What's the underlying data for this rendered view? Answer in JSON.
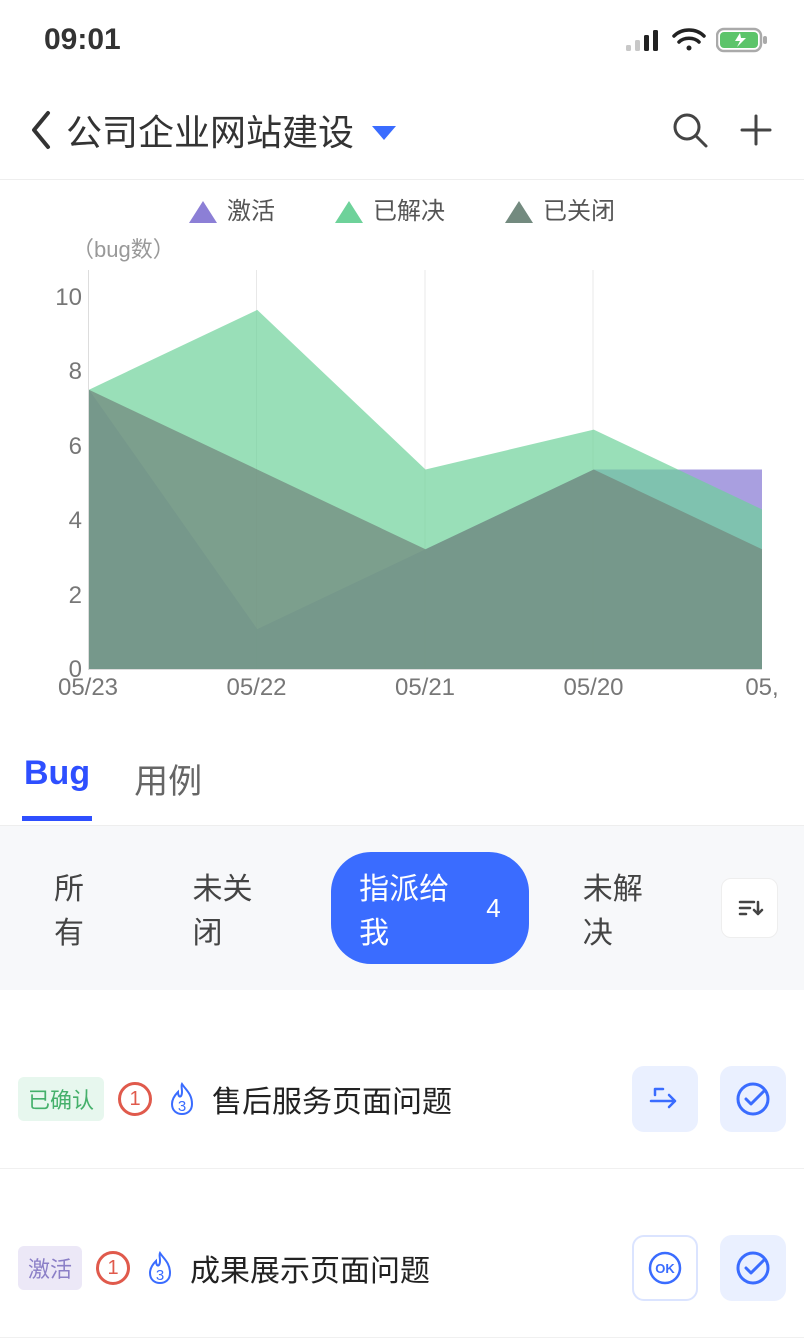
{
  "status": {
    "time": "09:01"
  },
  "header": {
    "title": "公司企业网站建设"
  },
  "chart_data": {
    "type": "area",
    "ylabel": "（bug数）",
    "ylim": [
      0,
      10
    ],
    "yticks": [
      10,
      8,
      6,
      4,
      2,
      0
    ],
    "categories": [
      "05/23",
      "05/22",
      "05/21",
      "05/20",
      "05,"
    ],
    "series": [
      {
        "name": "激活",
        "color": "#8c7fd6",
        "values": [
          7,
          1,
          3,
          5,
          5
        ]
      },
      {
        "name": "已解决",
        "color": "#6ed29a",
        "values": [
          7,
          9,
          5,
          6,
          4
        ]
      },
      {
        "name": "已关闭",
        "color": "#738a7f",
        "values": [
          7,
          5,
          3,
          5,
          3
        ]
      }
    ]
  },
  "tabs": [
    "Bug",
    "用例"
  ],
  "active_tab": 0,
  "filters": {
    "items": [
      {
        "label": "所有"
      },
      {
        "label": "未关闭"
      },
      {
        "label": "指派给我",
        "count": "4",
        "active": true
      },
      {
        "label": "未解决"
      }
    ]
  },
  "bugs": [
    {
      "status_tag": "已确认",
      "status_type": "confirmed",
      "priority": "1",
      "flame": "3",
      "title": "售后服务页面问题",
      "action1": "hand",
      "action2": "check"
    },
    {
      "status_tag": "激活",
      "status_type": "active-tag",
      "priority": "1",
      "flame": "3",
      "title": "成果展示页面问题",
      "action1": "ok",
      "action2": "check"
    }
  ]
}
